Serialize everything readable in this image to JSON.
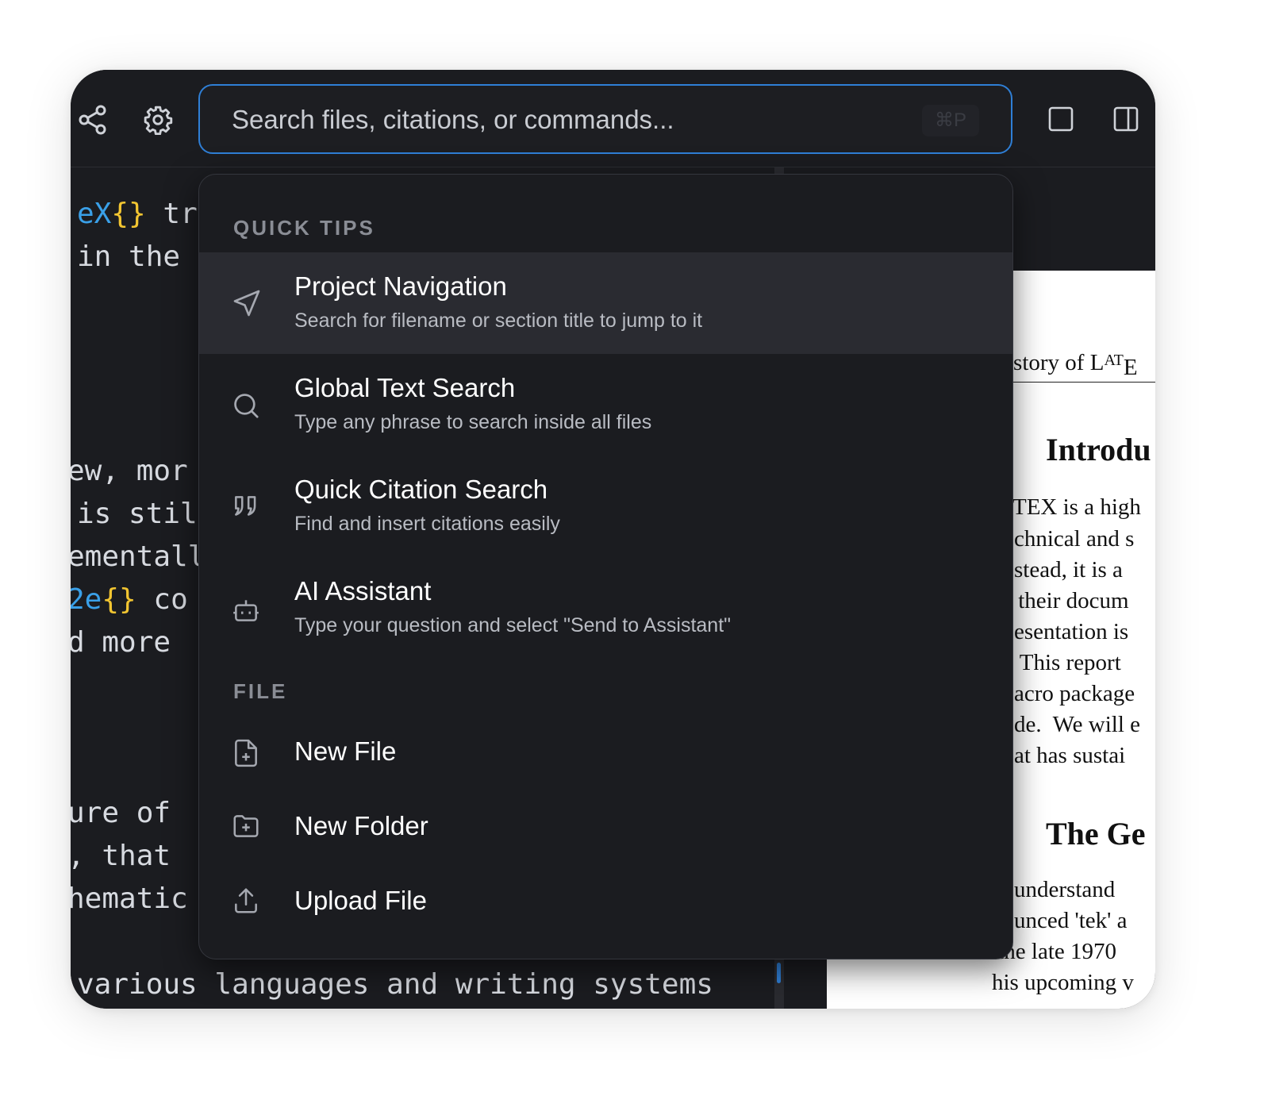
{
  "toolbar": {
    "share_icon": "share-icon",
    "settings_icon": "gear-icon",
    "search_placeholder": "Search files, citations, or commands...",
    "search_shortcut": "⌘P",
    "single_pane_icon": "square-icon",
    "split_pane_icon": "split-view-icon"
  },
  "editor": {
    "lines": [
      {
        "parts": [
          "eX",
          "{}",
          " tr"
        ]
      },
      {
        "text": "in the"
      },
      {
        "text": "ew, mor"
      },
      {
        "text": "is stil"
      },
      {
        "text": "ementall"
      },
      {
        "parts": [
          "2e",
          "{}",
          " co"
        ]
      },
      {
        "text": "d more"
      },
      {
        "text": "ure of"
      },
      {
        "text": ", that"
      },
      {
        "text": "hematic"
      },
      {
        "text": "various languages and writing systems"
      }
    ]
  },
  "preview": {
    "header": "istory of L",
    "header_logo": "AT",
    "header_logo_tail": "E",
    "heading_intro": "Introdu",
    "intro_lines": [
      "EX is a high",
      "chnical and s",
      "stead, it is a",
      " their docum",
      "esentation is",
      " This report",
      "acro package",
      "de.  We will e",
      "at has sustai"
    ],
    "intro_first_prefix": "T",
    "heading_genesis": "The Ge",
    "genesis_lines": [
      "understand",
      "unced 'tek' a",
      " the late 1970",
      "his upcoming v"
    ]
  },
  "palette": {
    "quick_tips_label": "QUICK TIPS",
    "tips": [
      {
        "icon": "navigation-arrow-icon",
        "title": "Project Navigation",
        "subtitle": "Search for filename or section title to jump to it"
      },
      {
        "icon": "search-icon",
        "title": "Global Text Search",
        "subtitle": "Type any phrase to search inside all files"
      },
      {
        "icon": "quote-icon",
        "title": "Quick Citation Search",
        "subtitle": "Find and insert citations easily"
      },
      {
        "icon": "robot-icon",
        "title": "AI Assistant",
        "subtitle": "Type your question and select \"Send to Assistant\""
      }
    ],
    "file_label": "FILE",
    "file_actions": [
      {
        "icon": "new-file-icon",
        "title": "New File"
      },
      {
        "icon": "new-folder-icon",
        "title": "New Folder"
      },
      {
        "icon": "upload-icon",
        "title": "Upload File"
      }
    ]
  }
}
